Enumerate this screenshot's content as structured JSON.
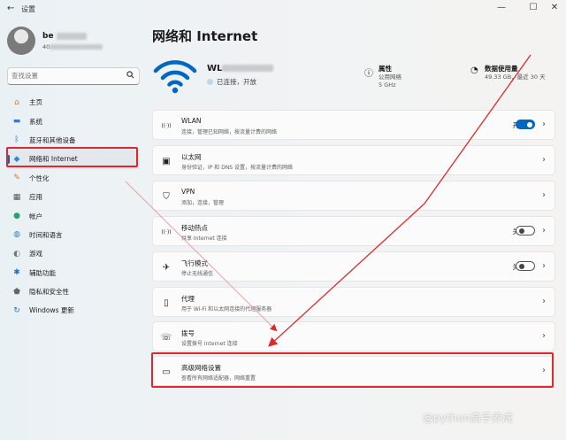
{
  "window": {
    "title": "设置",
    "back": "←",
    "minimize": "—",
    "maximize": "☐",
    "close": "✕"
  },
  "profile": {
    "name": "be",
    "email": "40"
  },
  "search": {
    "placeholder": "查找设置",
    "icon": "search-icon"
  },
  "sidebar": {
    "items": [
      {
        "label": "主页",
        "icon": "home-icon",
        "glyph": "⌂",
        "color": "#d97b2b"
      },
      {
        "label": "系统",
        "icon": "monitor-icon",
        "glyph": "▬",
        "color": "#2f7dd1"
      },
      {
        "label": "蓝牙和其他设备",
        "icon": "bluetooth-icon",
        "glyph": "ᛒ",
        "color": "#1f6fd1"
      },
      {
        "label": "网络和 Internet",
        "icon": "wifi-icon",
        "glyph": "◆",
        "color": "#2a8ad6",
        "active": true
      },
      {
        "label": "个性化",
        "icon": "brush-icon",
        "glyph": "✎",
        "color": "#d1772a"
      },
      {
        "label": "应用",
        "icon": "apps-icon",
        "glyph": "▦",
        "color": "#555"
      },
      {
        "label": "帐户",
        "icon": "person-icon",
        "glyph": "●",
        "color": "#2aa36a"
      },
      {
        "label": "时间和语言",
        "icon": "globe-icon",
        "glyph": "◍",
        "color": "#2a86c7"
      },
      {
        "label": "游戏",
        "icon": "gamepad-icon",
        "glyph": "◐",
        "color": "#777"
      },
      {
        "label": "辅助功能",
        "icon": "accessibility-icon",
        "glyph": "✱",
        "color": "#1f6fd1"
      },
      {
        "label": "隐私和安全性",
        "icon": "shield-icon",
        "glyph": "⬟",
        "color": "#666"
      },
      {
        "label": "Windows 更新",
        "icon": "update-icon",
        "glyph": "↻",
        "color": "#1f6fd1"
      }
    ]
  },
  "page_title": "网络和 Internet",
  "hero": {
    "ssid": "WL",
    "status": "已连接，开放",
    "properties": {
      "title": "属性",
      "line1": "公用网络",
      "line2": "5 GHz"
    },
    "usage": {
      "title": "数据使用量",
      "line1": "49.33 GB，最近 30 天"
    }
  },
  "cards": [
    {
      "title": "WLAN",
      "subtitle": "连接，管理已知网络，按流量计费的网络",
      "icon": "wifi-icon",
      "glyph": "((·))",
      "state": "开",
      "toggle": "on"
    },
    {
      "title": "以太网",
      "subtitle": "身份验证，IP 和 DNS 设置，按流量计费的网络",
      "icon": "ethernet-icon",
      "glyph": "▣"
    },
    {
      "title": "VPN",
      "subtitle": "添加，连接，管理",
      "icon": "vpn-shield-icon",
      "glyph": "⛉"
    },
    {
      "title": "移动热点",
      "subtitle": "共享 Internet 连接",
      "icon": "hotspot-icon",
      "glyph": "((·))",
      "state": "关",
      "toggle": "off"
    },
    {
      "title": "飞行模式",
      "subtitle": "停止无线通信",
      "icon": "airplane-icon",
      "glyph": "✈",
      "state": "关",
      "toggle": "off"
    },
    {
      "title": "代理",
      "subtitle": "用于 Wi-Fi 和以太网连接的代理服务器",
      "icon": "proxy-icon",
      "glyph": "▯"
    },
    {
      "title": "拨号",
      "subtitle": "设置拨号 Internet 连接",
      "icon": "dialup-icon",
      "glyph": "☏"
    },
    {
      "title": "高级网络设置",
      "subtitle": "查看所有网络适配器，网络重置",
      "icon": "network-adapter-icon",
      "glyph": "▭"
    }
  ],
  "chevron": "›",
  "watermark": "@python高手养成",
  "colors": {
    "accent": "#0067c0",
    "highlight": "#e0282a"
  }
}
